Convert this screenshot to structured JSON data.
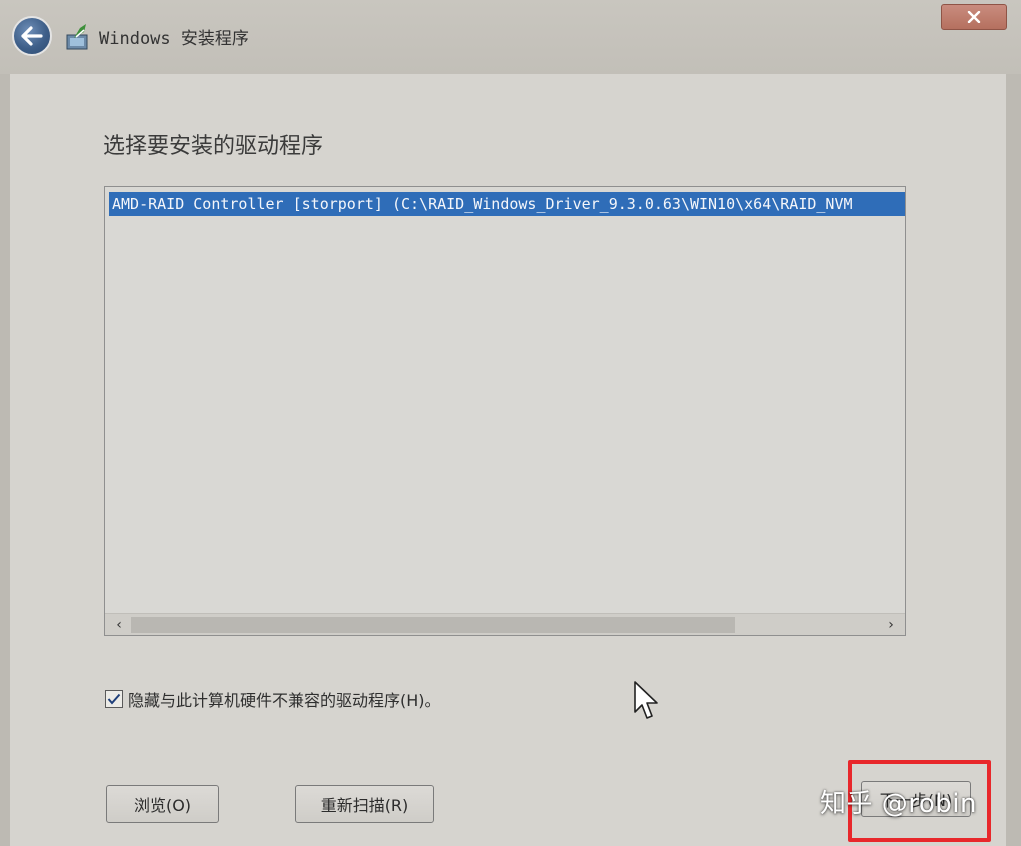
{
  "window": {
    "title": "Windows 安装程序"
  },
  "main": {
    "heading": "选择要安装的驱动程序",
    "driver_list": {
      "items": [
        {
          "label": "AMD-RAID Controller [storport] (C:\\RAID_Windows_Driver_9.3.0.63\\WIN10\\x64\\RAID_NVM",
          "selected": true
        }
      ]
    },
    "hide_incompatible": {
      "label": "隐藏与此计算机硬件不兼容的驱动程序(H)。",
      "checked": true
    }
  },
  "buttons": {
    "browse_label": "浏览(O)",
    "rescan_label": "重新扫描(R)",
    "next_label": "下一步(N)"
  },
  "overlay": {
    "watermark": "知乎 @robin",
    "highlight_color": "#e8272b"
  },
  "colors": {
    "selection": "#2f6db8",
    "back_button": "#3e5f89",
    "close_button": "#b5705f"
  },
  "icons": {
    "back": "arrow-left-icon",
    "app": "windows-setup-icon",
    "close": "close-icon",
    "check": "checkmark-icon",
    "scroll_left": "chevron-left-icon",
    "scroll_right": "chevron-right-icon",
    "cursor": "mouse-pointer-icon"
  }
}
